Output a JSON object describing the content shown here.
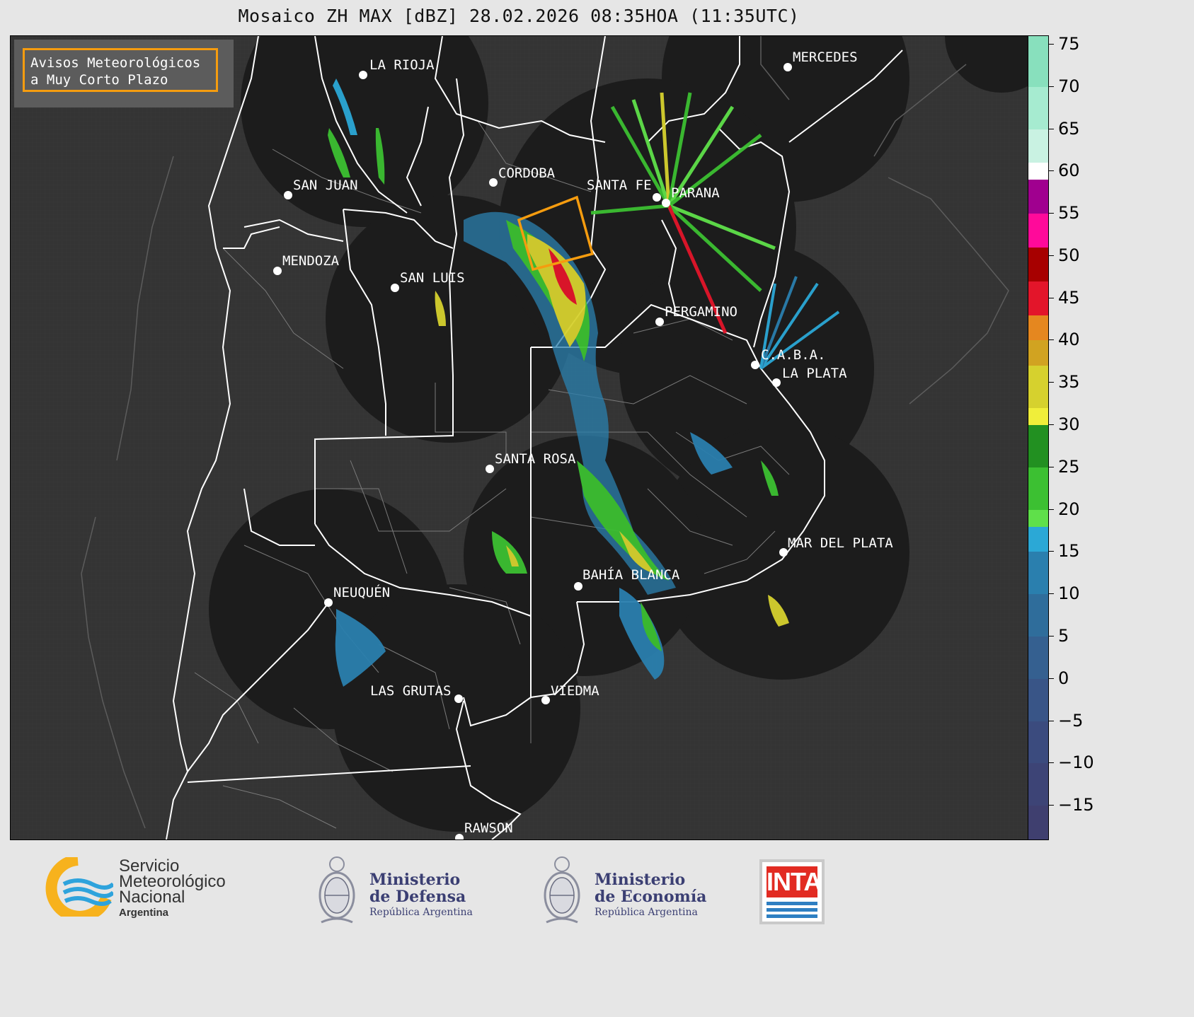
{
  "title": "Mosaico ZH MAX [dBZ] 28.02.2026 08:35HOA (11:35UTC)",
  "warning_box": {
    "line1": "Avisos Meteorológicos",
    "line2": "a Muy Corto Plazo",
    "border_color": "#f59c0f"
  },
  "cities": [
    {
      "name": "LA RIOJA"
    },
    {
      "name": "MERCEDES"
    },
    {
      "name": "CORDOBA"
    },
    {
      "name": "SAN JUAN"
    },
    {
      "name": "SANTA FE"
    },
    {
      "name": "PARANA"
    },
    {
      "name": "MENDOZA"
    },
    {
      "name": "SAN LUIS"
    },
    {
      "name": "PERGAMINO"
    },
    {
      "name": "C.A.B.A."
    },
    {
      "name": "LA PLATA"
    },
    {
      "name": "SANTA ROSA"
    },
    {
      "name": "MAR DEL PLATA"
    },
    {
      "name": "BAHÍA BLANCA"
    },
    {
      "name": "NEUQUÉN"
    },
    {
      "name": "LAS GRUTAS"
    },
    {
      "name": "VIEDMA"
    },
    {
      "name": "RAWSON"
    }
  ],
  "colorbar": {
    "unit": "dBZ",
    "min": -19,
    "max": 76,
    "ticks": [
      "75",
      "70",
      "65",
      "60",
      "55",
      "50",
      "45",
      "40",
      "35",
      "30",
      "25",
      "20",
      "15",
      "10",
      "5",
      "0",
      "−5",
      "−10",
      "−15"
    ],
    "tick_values": [
      75,
      70,
      65,
      60,
      55,
      50,
      45,
      40,
      35,
      30,
      25,
      20,
      15,
      10,
      5,
      0,
      -5,
      -10,
      -15
    ],
    "colors": [
      {
        "from": -19,
        "to": -15,
        "color": "#3f3f6f"
      },
      {
        "from": -15,
        "to": -10,
        "color": "#3d4476"
      },
      {
        "from": -10,
        "to": -5,
        "color": "#3b4b7e"
      },
      {
        "from": -5,
        "to": 0,
        "color": "#395587"
      },
      {
        "from": 0,
        "to": 5,
        "color": "#356090"
      },
      {
        "from": 5,
        "to": 10,
        "color": "#2f6d9b"
      },
      {
        "from": 10,
        "to": 15,
        "color": "#2a7fae"
      },
      {
        "from": 15,
        "to": 18,
        "color": "#2ba8d6"
      },
      {
        "from": 18,
        "to": 20,
        "color": "#5fe04a"
      },
      {
        "from": 20,
        "to": 25,
        "color": "#3cc032"
      },
      {
        "from": 25,
        "to": 30,
        "color": "#229021"
      },
      {
        "from": 30,
        "to": 32,
        "color": "#f0ee3a"
      },
      {
        "from": 32,
        "to": 37,
        "color": "#d6d12e"
      },
      {
        "from": 37,
        "to": 40,
        "color": "#d1a321"
      },
      {
        "from": 40,
        "to": 43,
        "color": "#e5871f"
      },
      {
        "from": 43,
        "to": 47,
        "color": "#e3152a"
      },
      {
        "from": 47,
        "to": 51,
        "color": "#a70000"
      },
      {
        "from": 51,
        "to": 55,
        "color": "#ff0a9a"
      },
      {
        "from": 55,
        "to": 59,
        "color": "#a0008f"
      },
      {
        "from": 59,
        "to": 61,
        "color": "#ffffff"
      },
      {
        "from": 61,
        "to": 65,
        "color": "#c9f2e2"
      },
      {
        "from": 65,
        "to": 70,
        "color": "#a6ebd0"
      },
      {
        "from": 70,
        "to": 76,
        "color": "#88e0bd"
      }
    ]
  },
  "footer": {
    "smn_line1": "Servicio",
    "smn_line2": "Meteorológico",
    "smn_line3": "Nacional",
    "smn_line4": "Argentina",
    "defensa_line1": "Ministerio",
    "defensa_line2": "de Defensa",
    "defensa_line3": "República Argentina",
    "economia_line1": "Ministerio",
    "economia_line2": "de Economía",
    "economia_line3": "República Argentina",
    "inta": "INTA"
  }
}
